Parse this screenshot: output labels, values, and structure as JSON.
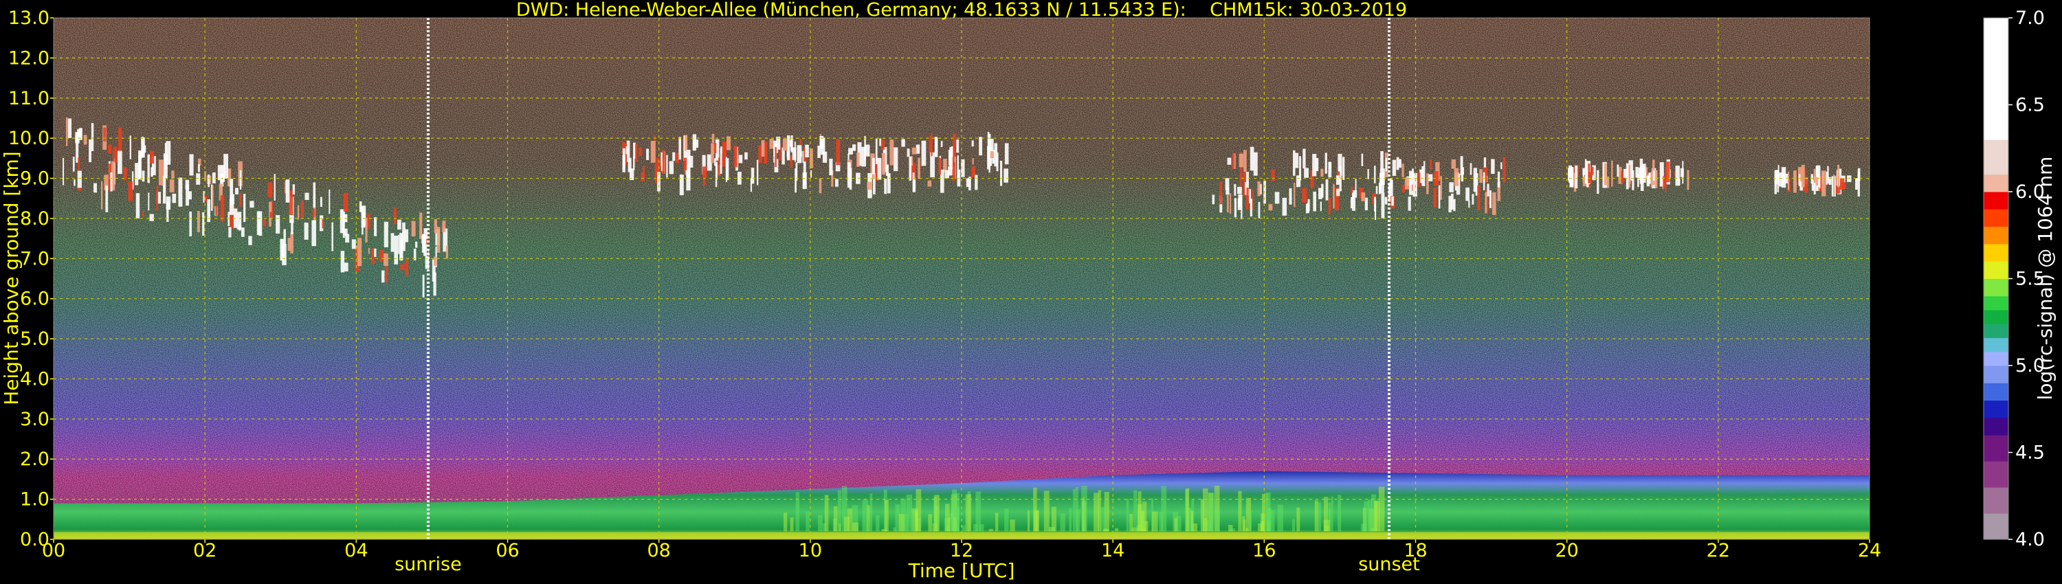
{
  "chart_data": {
    "type": "heatmap",
    "title": "DWD: Helene-Weber-Allee (München, Germany; 48.1633 N / 11.5433 E):    CHM15k: 30-03-2019",
    "xlabel": "Time [UTC]",
    "ylabel": "Height above ground [km]",
    "xlim": [
      0,
      24
    ],
    "ylim": [
      0,
      13
    ],
    "x_ticks": [
      "00",
      "02",
      "04",
      "06",
      "08",
      "10",
      "12",
      "14",
      "16",
      "18",
      "20",
      "22",
      "24"
    ],
    "y_ticks": [
      "0.0",
      "1.0",
      "2.0",
      "3.0",
      "4.0",
      "5.0",
      "6.0",
      "7.0",
      "8.0",
      "9.0",
      "10.0",
      "11.0",
      "12.0",
      "13.0"
    ],
    "grid": true,
    "events": [
      {
        "label": "sunrise",
        "time": 4.95
      },
      {
        "label": "sunset",
        "time": 17.65
      }
    ],
    "colorbar": {
      "label": "log(rc-signal) @ 1064 nm",
      "range": [
        4.0,
        7.0
      ],
      "ticks": [
        "4.0",
        "4.5",
        "5.0",
        "5.5",
        "6.0",
        "6.5",
        "7.0"
      ],
      "stops": [
        {
          "v": 4.0,
          "c": "#a898a8"
        },
        {
          "v": 4.15,
          "c": "#a07098"
        },
        {
          "v": 4.3,
          "c": "#903888"
        },
        {
          "v": 4.45,
          "c": "#701880"
        },
        {
          "v": 4.6,
          "c": "#400888"
        },
        {
          "v": 4.7,
          "c": "#1820c0"
        },
        {
          "v": 4.8,
          "c": "#4068e0"
        },
        {
          "v": 4.9,
          "c": "#8098f0"
        },
        {
          "v": 5.0,
          "c": "#a0b0ff"
        },
        {
          "v": 5.08,
          "c": "#60c0d8"
        },
        {
          "v": 5.16,
          "c": "#20a870"
        },
        {
          "v": 5.24,
          "c": "#10b040"
        },
        {
          "v": 5.32,
          "c": "#30d040"
        },
        {
          "v": 5.4,
          "c": "#80e840"
        },
        {
          "v": 5.5,
          "c": "#e0f020"
        },
        {
          "v": 5.6,
          "c": "#ffd000"
        },
        {
          "v": 5.7,
          "c": "#ff8c00"
        },
        {
          "v": 5.8,
          "c": "#ff4000"
        },
        {
          "v": 5.9,
          "c": "#f00000"
        },
        {
          "v": 6.0,
          "c": "#f0b8a0"
        },
        {
          "v": 6.1,
          "c": "#ecd8d0"
        },
        {
          "v": 6.3,
          "c": "#ffffff"
        },
        {
          "v": 7.0,
          "c": "#ffffff"
        }
      ]
    },
    "features": {
      "boundary_layer_top_km": [
        {
          "t": 0,
          "h": 0.9
        },
        {
          "t": 4,
          "h": 0.9
        },
        {
          "t": 6,
          "h": 0.95
        },
        {
          "t": 8,
          "h": 1.1
        },
        {
          "t": 10,
          "h": 1.25
        },
        {
          "t": 12,
          "h": 1.4
        },
        {
          "t": 14,
          "h": 1.6
        },
        {
          "t": 16,
          "h": 1.7
        },
        {
          "t": 18,
          "h": 1.65
        },
        {
          "t": 20,
          "h": 1.6
        },
        {
          "t": 22,
          "h": 1.6
        },
        {
          "t": 24,
          "h": 1.6
        }
      ],
      "cloud_layers": [
        {
          "t_start": 0.1,
          "t_end": 5.2,
          "base_km": 6.7,
          "top_km": 10.4
        },
        {
          "t_start": 7.5,
          "t_end": 12.6,
          "base_km": 8.8,
          "top_km": 9.9
        },
        {
          "t_start": 15.3,
          "t_end": 17.6,
          "base_km": 8.2,
          "top_km": 9.5
        },
        {
          "t_start": 17.6,
          "t_end": 19.2,
          "base_km": 8.3,
          "top_km": 9.4
        },
        {
          "t_start": 20.0,
          "t_end": 21.6,
          "base_km": 8.9,
          "top_km": 9.2
        },
        {
          "t_start": 22.7,
          "t_end": 23.9,
          "base_km": 8.8,
          "top_km": 9.1
        }
      ]
    }
  }
}
